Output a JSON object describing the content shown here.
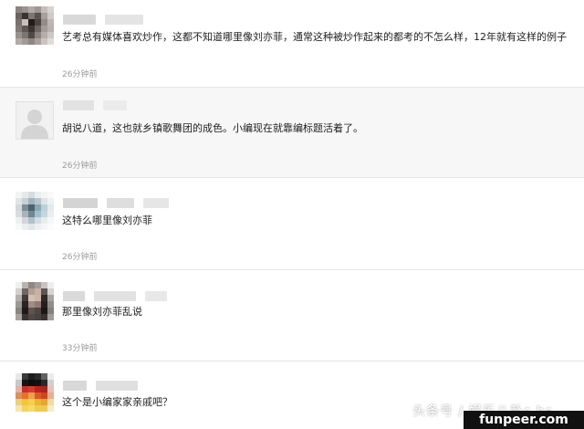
{
  "comments": [
    {
      "text": "艺考总有媒体喜欢炒作，这都不知道哪里像刘亦菲，通常这种被炒作起来的都考的不怎么样，12年就有这样的例子",
      "time": "26分钟前"
    },
    {
      "text": "胡说八道，这也就乡镇歌舞团的成色。小编现在就靠编标题活着了。",
      "time": "26分钟前"
    },
    {
      "text": "这特么哪里像刘亦菲",
      "time": "26分钟前"
    },
    {
      "text": "那里像刘亦菲乱说",
      "time": "33分钟前"
    },
    {
      "text": "这个是小编家家亲戚吧？"
    }
  ],
  "watermark": {
    "text": "头条号 / 娱乐八卦c hs"
  },
  "site_badge": {
    "text": "funpeer.com"
  }
}
